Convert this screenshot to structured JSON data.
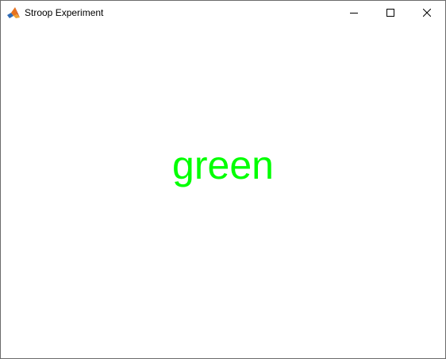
{
  "window": {
    "title": "Stroop Experiment",
    "app_icon": "matlab-icon",
    "controls": {
      "minimize_icon": "minimize-icon",
      "maximize_icon": "maximize-icon",
      "close_icon": "close-icon"
    }
  },
  "stimulus": {
    "word": "green",
    "ink_color": "#00ff00"
  }
}
